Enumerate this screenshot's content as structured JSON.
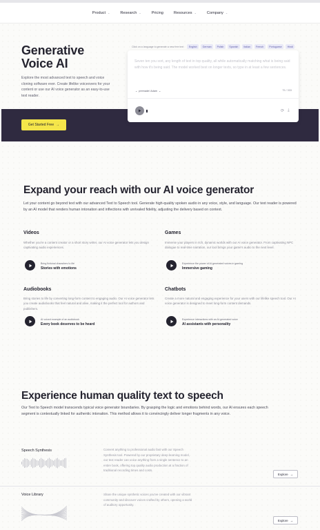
{
  "nav": {
    "items": [
      {
        "label": "Product",
        "dropdown": true
      },
      {
        "label": "Research",
        "dropdown": true
      },
      {
        "label": "Pricing",
        "dropdown": false
      },
      {
        "label": "Resources",
        "dropdown": true
      },
      {
        "label": "Company",
        "dropdown": true
      }
    ]
  },
  "hero": {
    "title_line1": "Generative",
    "title_line2": "Voice AI",
    "description": "Explore the most advanced text to speech and voice cloning software ever. Create lifelike voiceovers for your content or use our AI voice generator as an easy-to-use text reader.",
    "cta_label": "Get Started Free",
    "cta_arrow": "→",
    "accent_color": "#f5e64a",
    "dark_color": "#2f2a40"
  },
  "tts": {
    "language_hint": "Click on a language to generate a new free text",
    "languages": [
      "English",
      "German",
      "Polish",
      "Spanish",
      "Italian",
      "French",
      "Portuguese",
      "Hindi"
    ],
    "text": "Seven ten you sort, any length of text in top quality, all while automatically matching what is being said with how it's being said. The model worked best on longer texts, so type in at least a few sentences.",
    "voice_label": "premade/ Adam",
    "char_count": "75 / 333",
    "refresh_icon": "refresh-icon",
    "download_icon": "download-icon"
  },
  "section_voice": {
    "title": "Expand your reach with our AI voice generator",
    "description": "Let your content go beyond text with our advanced Text to Speech tool. Generate high-quality spoken audio in any voice, style, and language. Our text reader is powered by an AI model that renders human intonation and inflections with unrivaled fidelity, adjusting the delivery based on context.",
    "features": [
      {
        "title": "Videos",
        "description": "Whether you're a content creator or a short story writer, our AI voice generator lets you design captivating audio experiences.",
        "caption": "Bring fictional characters to life",
        "subtitle": "Stories with emotions"
      },
      {
        "title": "Games",
        "description": "Immerse your players in rich, dynamic worlds with our AI voice generator. From captivating NPC dialogue to real-time narration, our tool brings your game's audio to the next level.",
        "caption": "Experience the power of AI-generated voices in gaming",
        "subtitle": "Immersive gaming"
      },
      {
        "title": "Audiobooks",
        "description": "Bring stories to life by converting long-form content to engaging audio. Our AI voice generator lets you create audiobooks that feel natural and alive, making it the perfect tool for authors and publishers.",
        "caption": "AI voiced example of an audiobook",
        "subtitle": "Every book deserves to be heard"
      },
      {
        "title": "Chatbots",
        "description": "Create a more natural and engaging experience for your users with our lifelike speech tool. Our AI voice generator is designed to meet long-form content demands.",
        "caption": "Experience interactions with an AI-generated voice",
        "subtitle": "AI assistants with personality"
      }
    ]
  },
  "section_quality": {
    "title": "Experience human quality text to speech",
    "description": "Our Text to Speech model transcends typical voice generator boundaries. By grasping the logic and emotions behind words, our AI ensures each speech segment is contextually linked for authentic intonation. This method allows it to convincingly deliver longer fragments in any voice.",
    "rows": [
      {
        "title": "Speech Synthesis",
        "description": "Convert anything to professional audio fast with our Speech Synthesis tool. Powered by our proprietary deep learning model, our text reader can voice anything from a single sentence to an entire book, offering top quality audio production at a fraction of traditional recording times and costs.",
        "button": "Explore",
        "arrow": "→"
      },
      {
        "title": "Voice Library",
        "description": "Share the unique synthetic voices you've created with our vibrant community and discover voices crafted by others, opening a world of auditory opportunity.",
        "button": "Explore",
        "arrow": "→"
      }
    ]
  }
}
